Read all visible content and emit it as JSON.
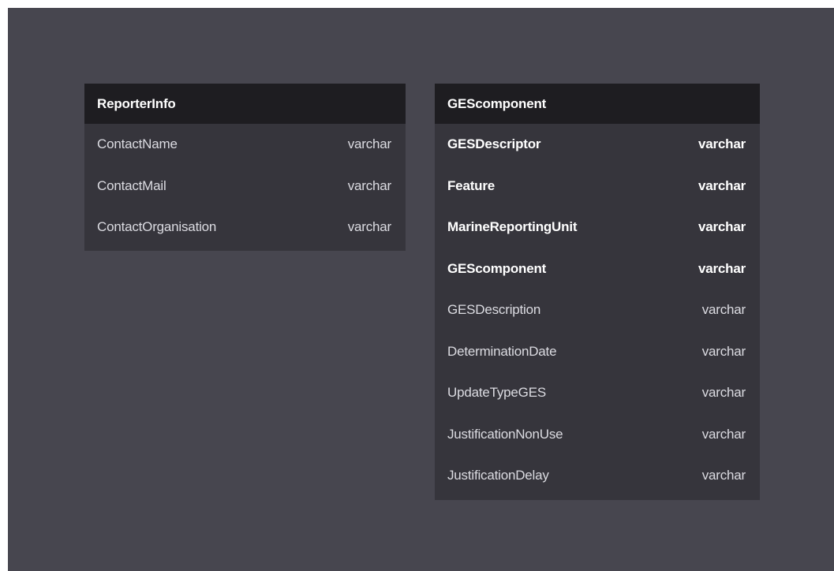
{
  "tables": [
    {
      "name": "ReporterInfo",
      "fields": [
        {
          "name": "ContactName",
          "type": "varchar",
          "key": false
        },
        {
          "name": "ContactMail",
          "type": "varchar",
          "key": false
        },
        {
          "name": "ContactOrganisation",
          "type": "varchar",
          "key": false
        }
      ]
    },
    {
      "name": "GEScomponent",
      "fields": [
        {
          "name": "GESDescriptor",
          "type": "varchar",
          "key": true
        },
        {
          "name": "Feature",
          "type": "varchar",
          "key": true
        },
        {
          "name": "MarineReportingUnit",
          "type": "varchar",
          "key": true
        },
        {
          "name": "GEScomponent",
          "type": "varchar",
          "key": true
        },
        {
          "name": "GESDescription",
          "type": "varchar",
          "key": false
        },
        {
          "name": "DeterminationDate",
          "type": "varchar",
          "key": false
        },
        {
          "name": "UpdateTypeGES",
          "type": "varchar",
          "key": false
        },
        {
          "name": "JustificationNonUse",
          "type": "varchar",
          "key": false
        },
        {
          "name": "JustificationDelay",
          "type": "varchar",
          "key": false
        }
      ]
    }
  ]
}
